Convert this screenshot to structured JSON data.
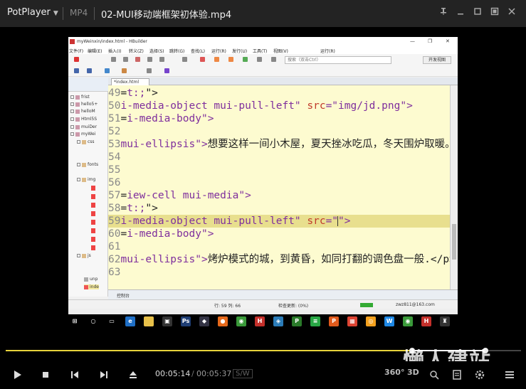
{
  "player": {
    "app_name": "PotPlayer",
    "format": "MP4",
    "file_title": "02-MUI移动端框架初体验.mp4",
    "time_current": "00:05:14",
    "time_separator": "/",
    "time_total": "00:05:37",
    "sw_label": "S/W",
    "progress_fraction": 0.931,
    "btn_360": "360°",
    "btn_3d": "3D",
    "watermark": "懒人建站"
  },
  "hbuilder": {
    "window_title": "myWeinxin/index.html - HBuilder",
    "menu": [
      "文件(F)",
      "编辑(E)",
      "插入(I)",
      "转义(Z)",
      "选择(S)",
      "跳转(G)",
      "查找(L)",
      "运行(R)",
      "发行(U)",
      "工具(T)",
      "视图(V)",
      "运行(R)"
    ],
    "search_placeholder": "搜索（双击Ctrl）",
    "open_view_label": "开发视图",
    "tab_label": "*index.html",
    "tree": [
      "frist",
      "hello5+",
      "helloM",
      "Html5S",
      "muiDer",
      "myWei",
      "css",
      "fonts",
      "img",
      "js",
      "unp",
      "inde"
    ],
    "console_label": "控制台",
    "status_line": "行: 59 列: 66",
    "status_check": "检查更新: (0%)",
    "status_user": "zwz811@163.com"
  },
  "code": [
    {
      "num": "49",
      "parts": [
        {
          "t": "=",
          "c": "black"
        },
        {
          "t": "t:;",
          "c": "purple"
        },
        {
          "t": "\">",
          "c": "black"
        }
      ]
    },
    {
      "num": "50",
      "parts": [
        {
          "t": "i-media-object mui-pull-left\" ",
          "c": "purple"
        },
        {
          "t": "src",
          "c": "red"
        },
        {
          "t": "=\"img/jd.png\">",
          "c": "purple"
        }
      ]
    },
    {
      "num": "51",
      "parts": [
        {
          "t": "=",
          "c": "black"
        },
        {
          "t": "i-media-body\">",
          "c": "purple"
        }
      ]
    },
    {
      "num": "52",
      "parts": []
    },
    {
      "num": "53",
      "parts": [
        {
          "t": "mui-ellipsis\">",
          "c": "purple"
        },
        {
          "t": "想要这样一间小木屋，夏天挫冰吃瓜，冬天围炉取暖。",
          "c": "black"
        }
      ]
    },
    {
      "num": "54",
      "parts": []
    },
    {
      "num": "55",
      "parts": []
    },
    {
      "num": "56",
      "parts": []
    },
    {
      "num": "57",
      "parts": [
        {
          "t": "=",
          "c": "black"
        },
        {
          "t": "iew-cell mui-media\">",
          "c": "purple"
        }
      ]
    },
    {
      "num": "58",
      "parts": [
        {
          "t": "=",
          "c": "black"
        },
        {
          "t": "t:;",
          "c": "purple"
        },
        {
          "t": "\">",
          "c": "black"
        }
      ]
    },
    {
      "num": "59",
      "parts": [
        {
          "t": "i-media-object mui-pull-left\" ",
          "c": "purple"
        },
        {
          "t": "src",
          "c": "red"
        },
        {
          "t": "=\"",
          "c": "purple"
        },
        {
          "t": "|",
          "c": "cursor"
        },
        {
          "t": "\">",
          "c": "purple"
        }
      ],
      "highlight": true
    },
    {
      "num": "60",
      "parts": [
        {
          "t": "=",
          "c": "black"
        },
        {
          "t": "i-media-body\">",
          "c": "purple"
        }
      ]
    },
    {
      "num": "61",
      "parts": []
    },
    {
      "num": "62",
      "parts": [
        {
          "t": "mui-ellipsis\">",
          "c": "purple"
        },
        {
          "t": "烤炉模式的城，到黄昏，如同打翻的调色盘一般.</p>",
          "c": "black"
        }
      ]
    },
    {
      "num": "63",
      "parts": []
    }
  ]
}
